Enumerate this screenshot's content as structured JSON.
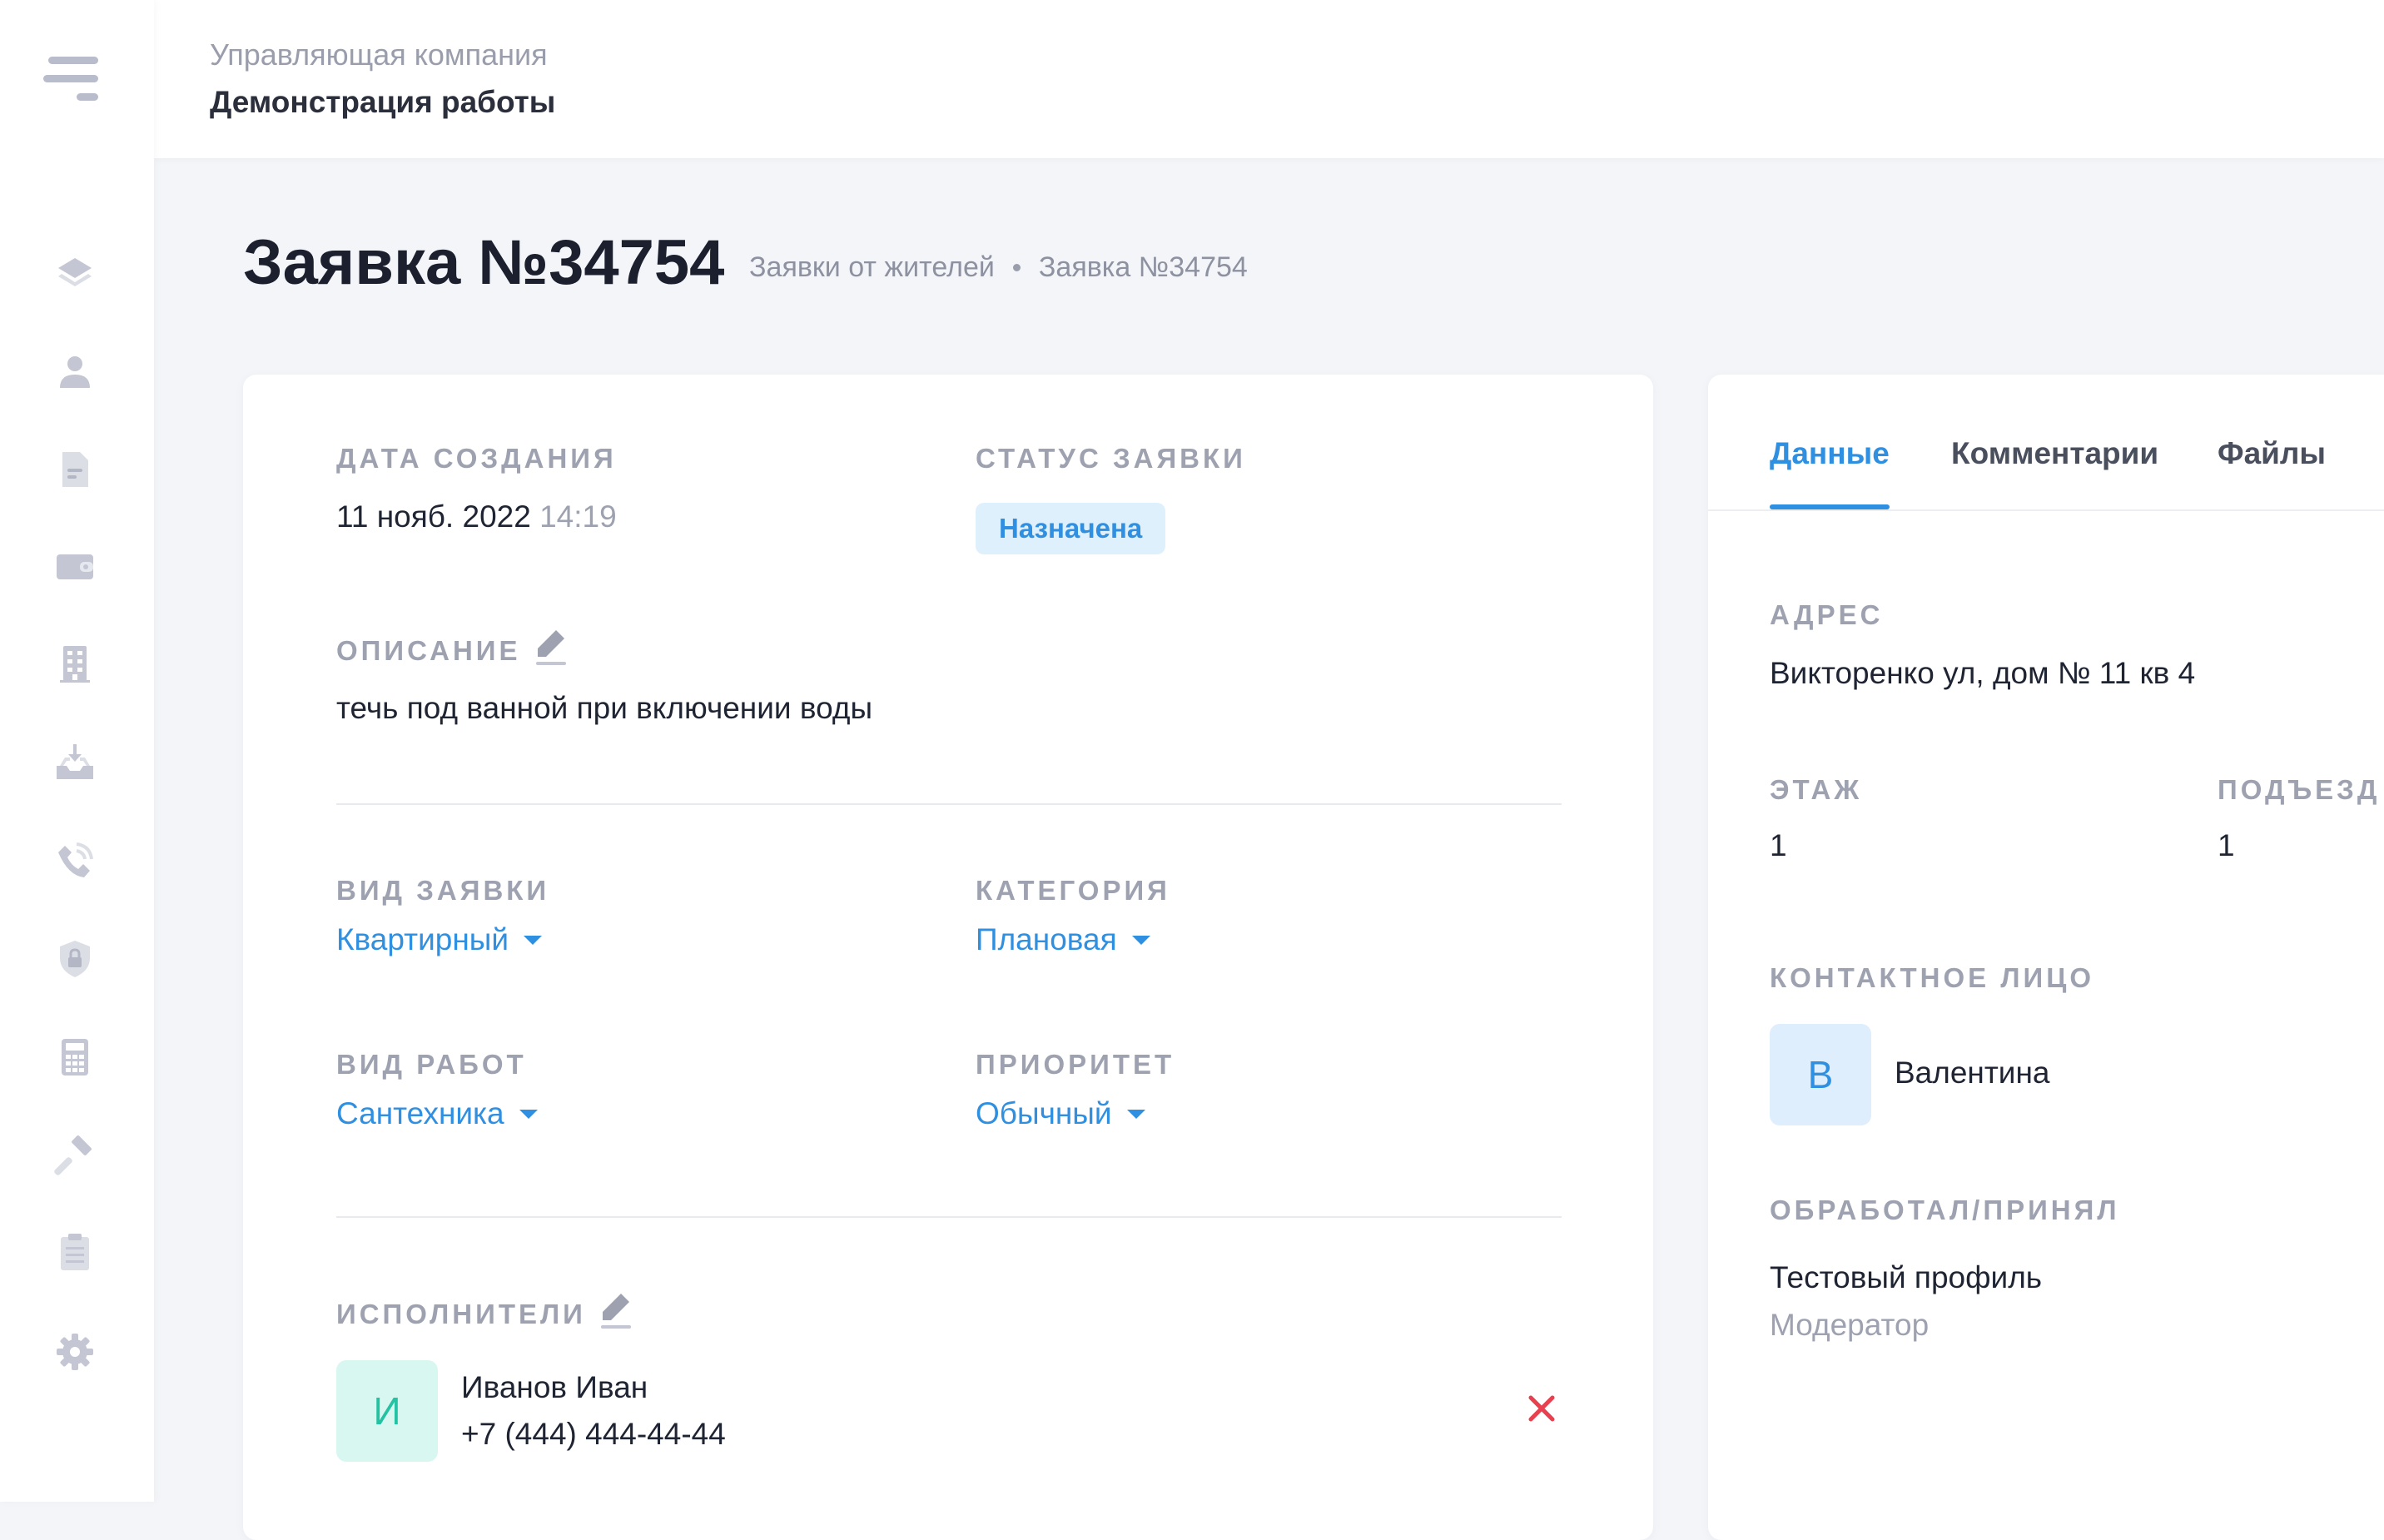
{
  "header": {
    "company_caption": "Управляющая компания",
    "company_name": "Демонстрация работы"
  },
  "sidebar": {
    "items": [
      {
        "icon": "layers-icon"
      },
      {
        "icon": "user-icon"
      },
      {
        "icon": "document-icon"
      },
      {
        "icon": "wallet-icon"
      },
      {
        "icon": "building-icon"
      },
      {
        "icon": "inbox-download-icon"
      },
      {
        "icon": "phone-icon"
      },
      {
        "icon": "shield-lock-icon"
      },
      {
        "icon": "calculator-icon"
      },
      {
        "icon": "hammer-icon"
      },
      {
        "icon": "clipboard-icon"
      },
      {
        "icon": "gear-icon"
      }
    ]
  },
  "page": {
    "title": "Заявка №34754",
    "breadcrumb": [
      "Заявки от жителей",
      "Заявка №34754"
    ]
  },
  "request": {
    "created_label": "Дата создания",
    "created_date": "11 нояб. 2022",
    "created_time": "14:19",
    "status_label": "Статус заявки",
    "status_value": "Назначена",
    "description_label": "Описание",
    "description_text": "течь под ванной при включении воды",
    "type_label": "Вид заявки",
    "type_value": "Квартирный",
    "category_label": "Категория",
    "category_value": "Плановая",
    "work_label": "Вид работ",
    "work_value": "Сантехника",
    "priority_label": "Приоритет",
    "priority_value": "Обычный",
    "executors_label": "Исполнители",
    "executor": {
      "initial": "И",
      "name": "Иванов Иван",
      "phone": "+7 (444) 444-44-44"
    }
  },
  "details": {
    "tabs": [
      "Данные",
      "Комментарии",
      "Файлы"
    ],
    "active_tab": "Данные",
    "address_label": "Адрес",
    "address_value": "Викторенко ул, дом № 11 кв 4",
    "floor_label": "Этаж",
    "floor_value": "1",
    "entrance_label": "Подъезд",
    "entrance_value": "1",
    "contact_label": "Контактное лицо",
    "contact_initial": "В",
    "contact_name": "Валентина",
    "processed_label": "Обработал/Принял",
    "processed_name": "Тестовый профиль",
    "processed_role": "Модератор"
  },
  "colors": {
    "accent": "#2f8fe0",
    "status_bg": "#dff0fd",
    "executor_avatar_bg": "#d9f7f1",
    "executor_avatar_fg": "#23c2a2",
    "remove": "#e8404f",
    "sidebar_icon": "#c4c7d3"
  }
}
